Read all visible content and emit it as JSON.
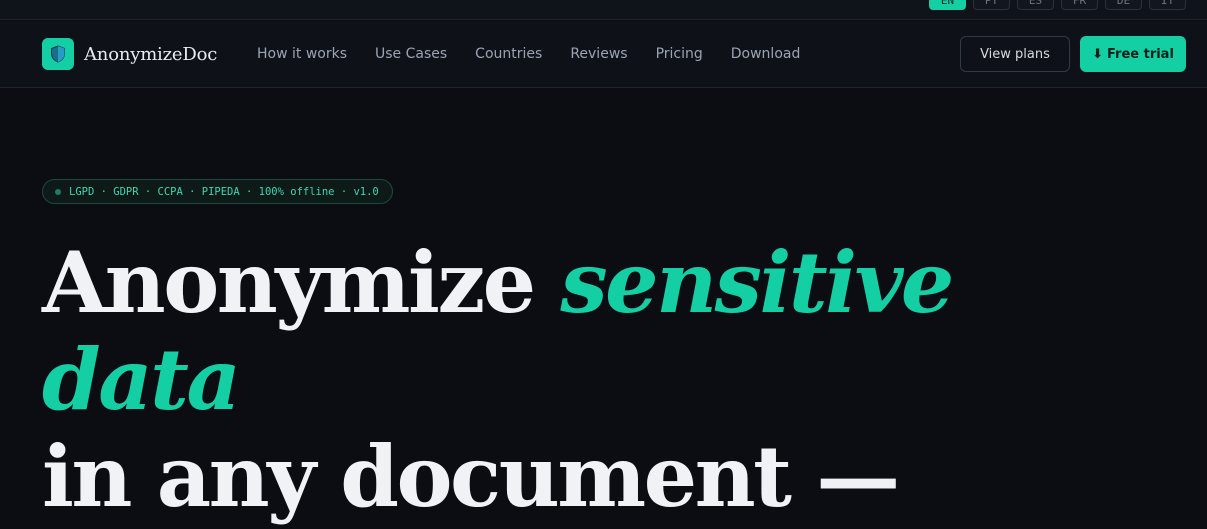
{
  "languages": [
    "EN",
    "PT",
    "ES",
    "FR",
    "DE",
    "IT"
  ],
  "active_language": "EN",
  "brand": {
    "name": "AnonymizeDoc",
    "logo_icon": "shield-icon"
  },
  "nav": {
    "links": [
      "How it works",
      "Use Cases",
      "Countries",
      "Reviews",
      "Pricing",
      "Download"
    ],
    "view_plans": "View plans",
    "free_trial": "Free trial",
    "free_trial_icon": "⬇"
  },
  "hero": {
    "badge": "LGPD · GDPR · CCPA · PIPEDA · 100% offline · v1.0",
    "headline": {
      "plain_1": "Anonymize ",
      "accent_1": "sensitive",
      "accent_2": "data",
      "plain_2": "in any document —"
    }
  },
  "colors": {
    "accent": "#14cfa4",
    "background": "#0b0d12",
    "nav_bg": "#0e1117"
  }
}
